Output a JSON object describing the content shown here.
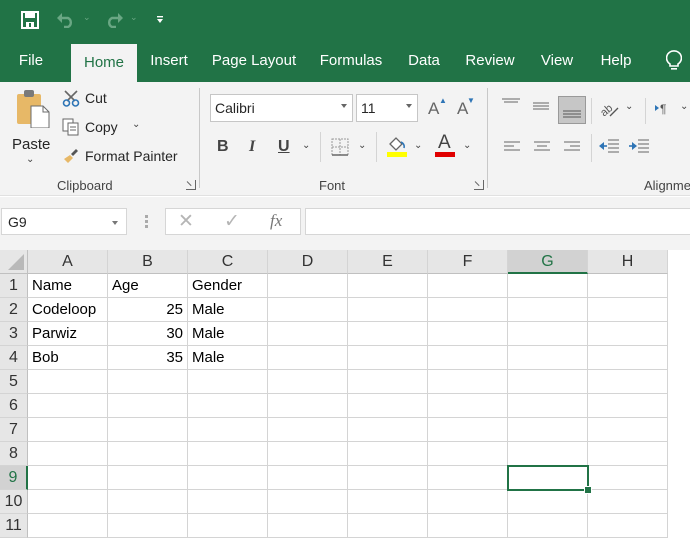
{
  "qat": {
    "save": "save-icon",
    "undo": "undo-icon",
    "redo": "redo-icon",
    "customize": "customize-qat-icon"
  },
  "tabs": [
    {
      "label": "File",
      "active": false
    },
    {
      "label": "Home",
      "active": true
    },
    {
      "label": "Insert",
      "active": false
    },
    {
      "label": "Page Layout",
      "active": false
    },
    {
      "label": "Formulas",
      "active": false
    },
    {
      "label": "Data",
      "active": false
    },
    {
      "label": "Review",
      "active": false
    },
    {
      "label": "View",
      "active": false
    },
    {
      "label": "Help",
      "active": false
    }
  ],
  "tell_me_icon": "lightbulb-icon",
  "ribbon": {
    "clipboard": {
      "label": "Clipboard",
      "paste": "Paste",
      "cut": "Cut",
      "copy": "Copy",
      "format_painter": "Format Painter"
    },
    "font": {
      "label": "Font",
      "font_name": "Calibri",
      "font_size": "11",
      "bold": "B",
      "italic": "I",
      "underline": "U",
      "fill_color": "#ffff00",
      "font_color": "#e00000",
      "font_color_glyph": "A",
      "grow_glyph": "A",
      "shrink_glyph": "A"
    },
    "alignment": {
      "label": "Alignme"
    }
  },
  "formula_bar": {
    "name_box": "G9",
    "cancel": "✕",
    "enter": "✓",
    "fx": "fx",
    "value": ""
  },
  "sheet": {
    "columns": [
      "A",
      "B",
      "C",
      "D",
      "E",
      "F",
      "G",
      "H"
    ],
    "rows": [
      "1",
      "2",
      "3",
      "4",
      "5",
      "6",
      "7",
      "8",
      "9",
      "10",
      "11"
    ],
    "selected_cell": "G9",
    "selected_column": "G",
    "selected_row": "9",
    "cells": [
      [
        "Name",
        "Age",
        "Gender"
      ],
      [
        "Codeloop",
        "25",
        "Male"
      ],
      [
        "Parwiz",
        "30",
        "Male"
      ],
      [
        "Bob",
        "35",
        "Male"
      ]
    ]
  },
  "colors": {
    "brand": "#217346",
    "ribbon_bg": "#f3f3f3"
  }
}
